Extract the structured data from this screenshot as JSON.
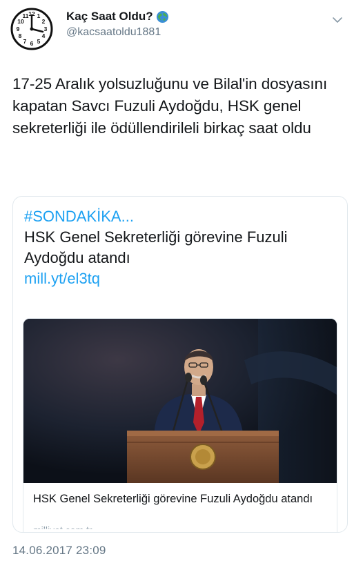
{
  "header": {
    "display_name": "Kaç Saat Oldu?",
    "handle": "@kacsaatoldu1881",
    "avatar_icon": "clock-icon",
    "badge_icon": "globe-icon",
    "menu_icon": "chevron-down-icon",
    "clock_numbers": [
      "12",
      "1",
      "2",
      "3",
      "4",
      "5",
      "6",
      "7",
      "8",
      "9",
      "10",
      "11"
    ]
  },
  "tweet": {
    "text": "17-25 Aralık yolsuzluğunu ve Bilal'in dosyasını kapatan Savcı Fuzuli Aydoğdu, HSK genel sekreterliği ile ödüllendirileli birkaç saat oldu",
    "timestamp": "14.06.2017 23:09"
  },
  "card": {
    "hashtag": "#SONDAKİKA...",
    "text": "HSK Genel Sekreterliği görevine Fuzuli Aydoğdu atandı",
    "link": "mill.yt/el3tq",
    "inner": {
      "title": "HSK Genel Sekreterliği görevine Fuzuli Aydoğdu atandı",
      "domain": "milliyet.com.tr"
    }
  },
  "colors": {
    "link": "#1da1f2",
    "text": "#14171a",
    "muted": "#657786",
    "border": "#e1e8ed"
  }
}
